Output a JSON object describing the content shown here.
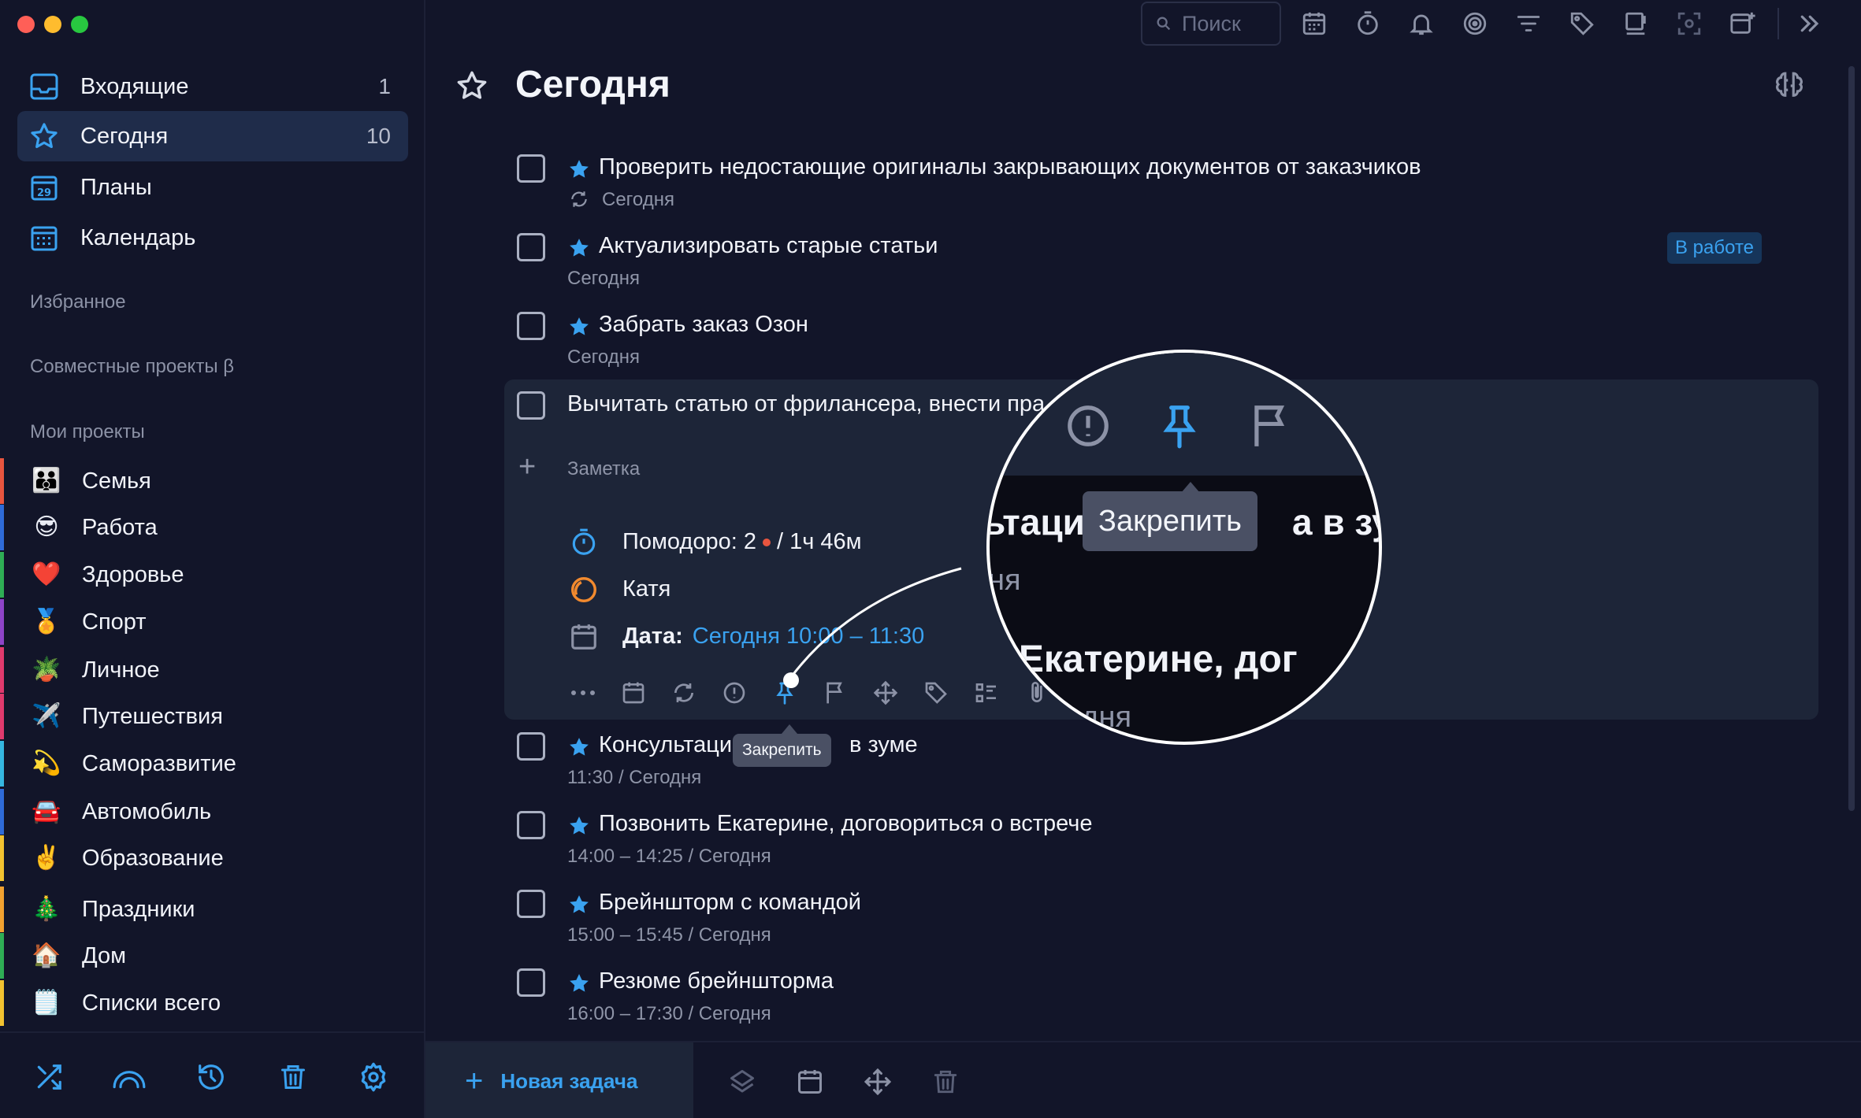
{
  "colors": {
    "accent": "#3aa2f0",
    "background": "#121529",
    "expanded_bg": "#1d2538",
    "active_nav": "#1f2c4a"
  },
  "sidebar": {
    "nav": [
      {
        "label": "Входящие",
        "count": "1",
        "icon": "inbox-icon"
      },
      {
        "label": "Сегодня",
        "count": "10",
        "icon": "star-icon"
      },
      {
        "label": "Планы",
        "count": "",
        "icon": "calendar-29-icon"
      },
      {
        "label": "Календарь",
        "count": "",
        "icon": "calendar-grid-icon"
      }
    ],
    "favorites_label": "Избранное",
    "shared_label": "Совместные проекты β",
    "my_projects_label": "Мои проекты",
    "projects": [
      {
        "label": "Семья",
        "emoji": "👪",
        "color": "#e8553f"
      },
      {
        "label": "Работа",
        "emoji": "😎",
        "color": "#2f6bd8"
      },
      {
        "label": "Здоровье",
        "emoji": "❤️",
        "color": "#2fae55"
      },
      {
        "label": "Спорт",
        "emoji": "🏅",
        "color": "#8e44c8"
      },
      {
        "label": "Личное",
        "emoji": "🪴",
        "color": "#e03a6d"
      },
      {
        "label": "Путешествия",
        "emoji": "✈️",
        "color": "#e03a6d"
      },
      {
        "label": "Саморазвитие",
        "emoji": "💫",
        "color": "#35b7e0"
      },
      {
        "label": "Автомобиль",
        "emoji": "🚘",
        "color": "#2f6bd8"
      },
      {
        "label": "Образование",
        "emoji": "✌️",
        "color": "#f2c230"
      },
      {
        "label": "Праздники",
        "emoji": "🎄",
        "color": "#f2a230"
      },
      {
        "label": "Дом",
        "emoji": "🏠",
        "color": "#2fae55"
      },
      {
        "label": "Списки всего",
        "emoji": "🗒️",
        "color": "#f2c230"
      }
    ]
  },
  "topbar": {
    "search_placeholder": "Поиск"
  },
  "main": {
    "title": "Сегодня",
    "tasks": [
      {
        "title": "Проверить недостающие оригиналы закрывающих документов от заказчиков",
        "sub": "Сегодня",
        "starred": true,
        "repeat": true
      },
      {
        "title": "Актуализировать старые статьи",
        "sub": "Сегодня",
        "starred": true,
        "badge": "В работе"
      },
      {
        "title": "Забрать заказ Озон",
        "sub": "Сегодня",
        "starred": true
      },
      {
        "title": "Вычитать статью от фрилансера, внести пра",
        "starred": false,
        "expanded": true
      },
      {
        "title": "Консультаци",
        "title_end": "в зуме",
        "sub": "11:30 / Сегодня",
        "starred": true
      },
      {
        "title": "Позвонить Екатерине, договориться о встрече",
        "sub": "14:00 – 14:25 / Сегодня",
        "starred": true
      },
      {
        "title": "Брейншторм с командой",
        "sub": "15:00 – 15:45 / Сегодня",
        "starred": true
      },
      {
        "title": "Резюме брейншторма",
        "sub": "16:00 – 17:30 / Сегодня",
        "starred": true
      }
    ],
    "expanded": {
      "note_label": "Заметка",
      "pomodoro": "Помодоро: 2",
      "pomodoro_time": "/ 1ч 46м",
      "assignee": "Катя",
      "date_label": "Дата:",
      "date_value": "Сегодня 10:00 – 11:30"
    },
    "tooltip_small": "Закрепить",
    "magnifier": {
      "tooltip": "Закрепить",
      "text_line1_left": "ьтаци",
      "text_line1_right": "а в зум",
      "text_line2": "ня",
      "text_line3": "ь Екатерине, дог",
      "text_line4": "одня"
    }
  },
  "bottombar": {
    "new_task_label": "Новая задача"
  }
}
